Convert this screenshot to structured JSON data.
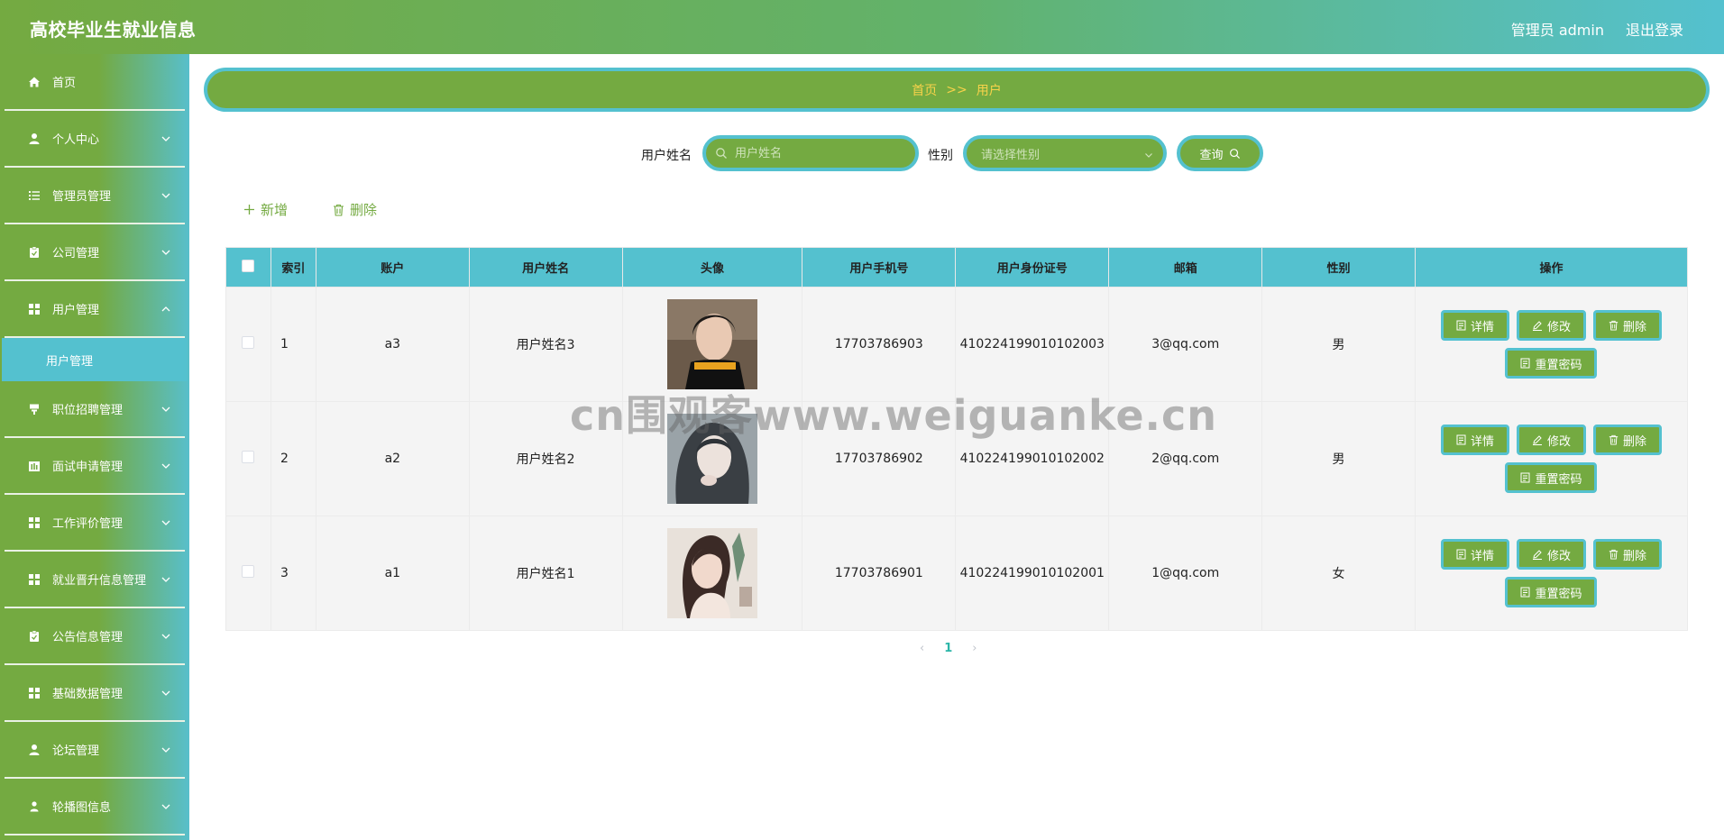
{
  "header": {
    "title": "高校毕业生就业信息",
    "user_label": "管理员 admin",
    "logout_label": "退出登录"
  },
  "sidebar": {
    "items": [
      {
        "label": "首页",
        "icon": "home-icon",
        "has_chevron": false
      },
      {
        "label": "个人中心",
        "icon": "user-icon",
        "has_chevron": true
      },
      {
        "label": "管理员管理",
        "icon": "list-icon",
        "has_chevron": true
      },
      {
        "label": "公司管理",
        "icon": "clipboard-icon",
        "has_chevron": true
      },
      {
        "label": "用户管理",
        "icon": "grid-icon",
        "has_chevron": true
      }
    ],
    "submenu": {
      "label": "用户管理"
    },
    "items2": [
      {
        "label": "职位招聘管理",
        "icon": "stand-icon",
        "has_chevron": true
      },
      {
        "label": "面试申请管理",
        "icon": "bars-icon",
        "has_chevron": true
      },
      {
        "label": "工作评价管理",
        "icon": "grid-icon",
        "has_chevron": true
      },
      {
        "label": "就业晋升信息管理",
        "icon": "grid-icon",
        "has_chevron": true
      },
      {
        "label": "公告信息管理",
        "icon": "clipboard-icon",
        "has_chevron": true
      },
      {
        "label": "基础数据管理",
        "icon": "grid-icon",
        "has_chevron": true
      },
      {
        "label": "论坛管理",
        "icon": "user-icon",
        "has_chevron": true
      },
      {
        "label": "轮播图信息",
        "icon": "user-down-icon",
        "has_chevron": true
      }
    ]
  },
  "breadcrumb": {
    "home": "首页",
    "sep": ">>",
    "current": "用户"
  },
  "search": {
    "name_label": "用户姓名",
    "name_placeholder": "用户姓名",
    "gender_label": "性别",
    "gender_placeholder": "请选择性别",
    "query_label": "查询"
  },
  "toolbar": {
    "add_label": "新增",
    "delete_label": "删除"
  },
  "table": {
    "headers": [
      "索引",
      "账户",
      "用户姓名",
      "头像",
      "用户手机号",
      "用户身份证号",
      "邮箱",
      "性别",
      "操作"
    ],
    "rows": [
      {
        "index": "1",
        "account": "a3",
        "name": "用户姓名3",
        "phone": "17703786903",
        "idcard": "410224199010102003",
        "email": "3@qq.com",
        "gender": "男"
      },
      {
        "index": "2",
        "account": "a2",
        "name": "用户姓名2",
        "phone": "17703786902",
        "idcard": "410224199010102002",
        "email": "2@qq.com",
        "gender": "男"
      },
      {
        "index": "3",
        "account": "a1",
        "name": "用户姓名1",
        "phone": "17703786901",
        "idcard": "410224199010102001",
        "email": "1@qq.com",
        "gender": "女"
      }
    ],
    "ops": {
      "detail": "详情",
      "edit": "修改",
      "delete": "删除",
      "reset": "重置密码"
    }
  },
  "pager": {
    "prev": "‹",
    "current": "1",
    "next": "›"
  },
  "watermark": "cn围观客www.weiguanke.cn",
  "colors": {
    "green": "#74aa41",
    "teal": "#54c1cf",
    "breadcrumb_text": "#f7d24a"
  }
}
